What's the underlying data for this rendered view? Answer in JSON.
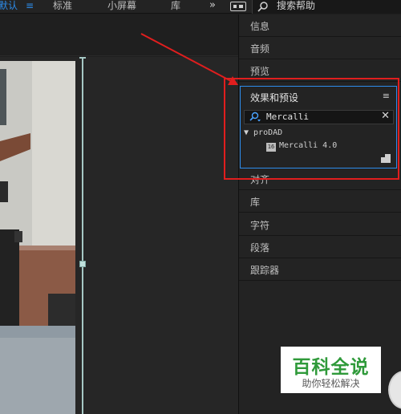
{
  "workspaces": {
    "active": "默认",
    "menu_icon": "hamburger-icon",
    "items": [
      "标准",
      "小屏幕",
      "库"
    ],
    "overflow_glyph": "»"
  },
  "help_search": {
    "icon": "search-icon",
    "placeholder": "搜索帮助"
  },
  "panels": {
    "top": [
      {
        "label": "信息"
      },
      {
        "label": "音频"
      },
      {
        "label": "预览"
      }
    ],
    "bottom": [
      {
        "label": "对齐"
      },
      {
        "label": "库"
      },
      {
        "label": "字符"
      },
      {
        "label": "段落"
      },
      {
        "label": "跟踪器"
      }
    ]
  },
  "effects_panel": {
    "title": "效果和预设",
    "menu_glyph": "≡",
    "search_value": "Mercalli",
    "clear_glyph": "✕",
    "folder": "▼ proDAD",
    "item_badge": "16",
    "item": "Mercalli 4.0"
  },
  "annotation": {
    "color": "#e01e1e"
  },
  "accent_color": "#2d8ceb",
  "watermark": {
    "big": "百科全说",
    "small": "助你轻松解决"
  }
}
